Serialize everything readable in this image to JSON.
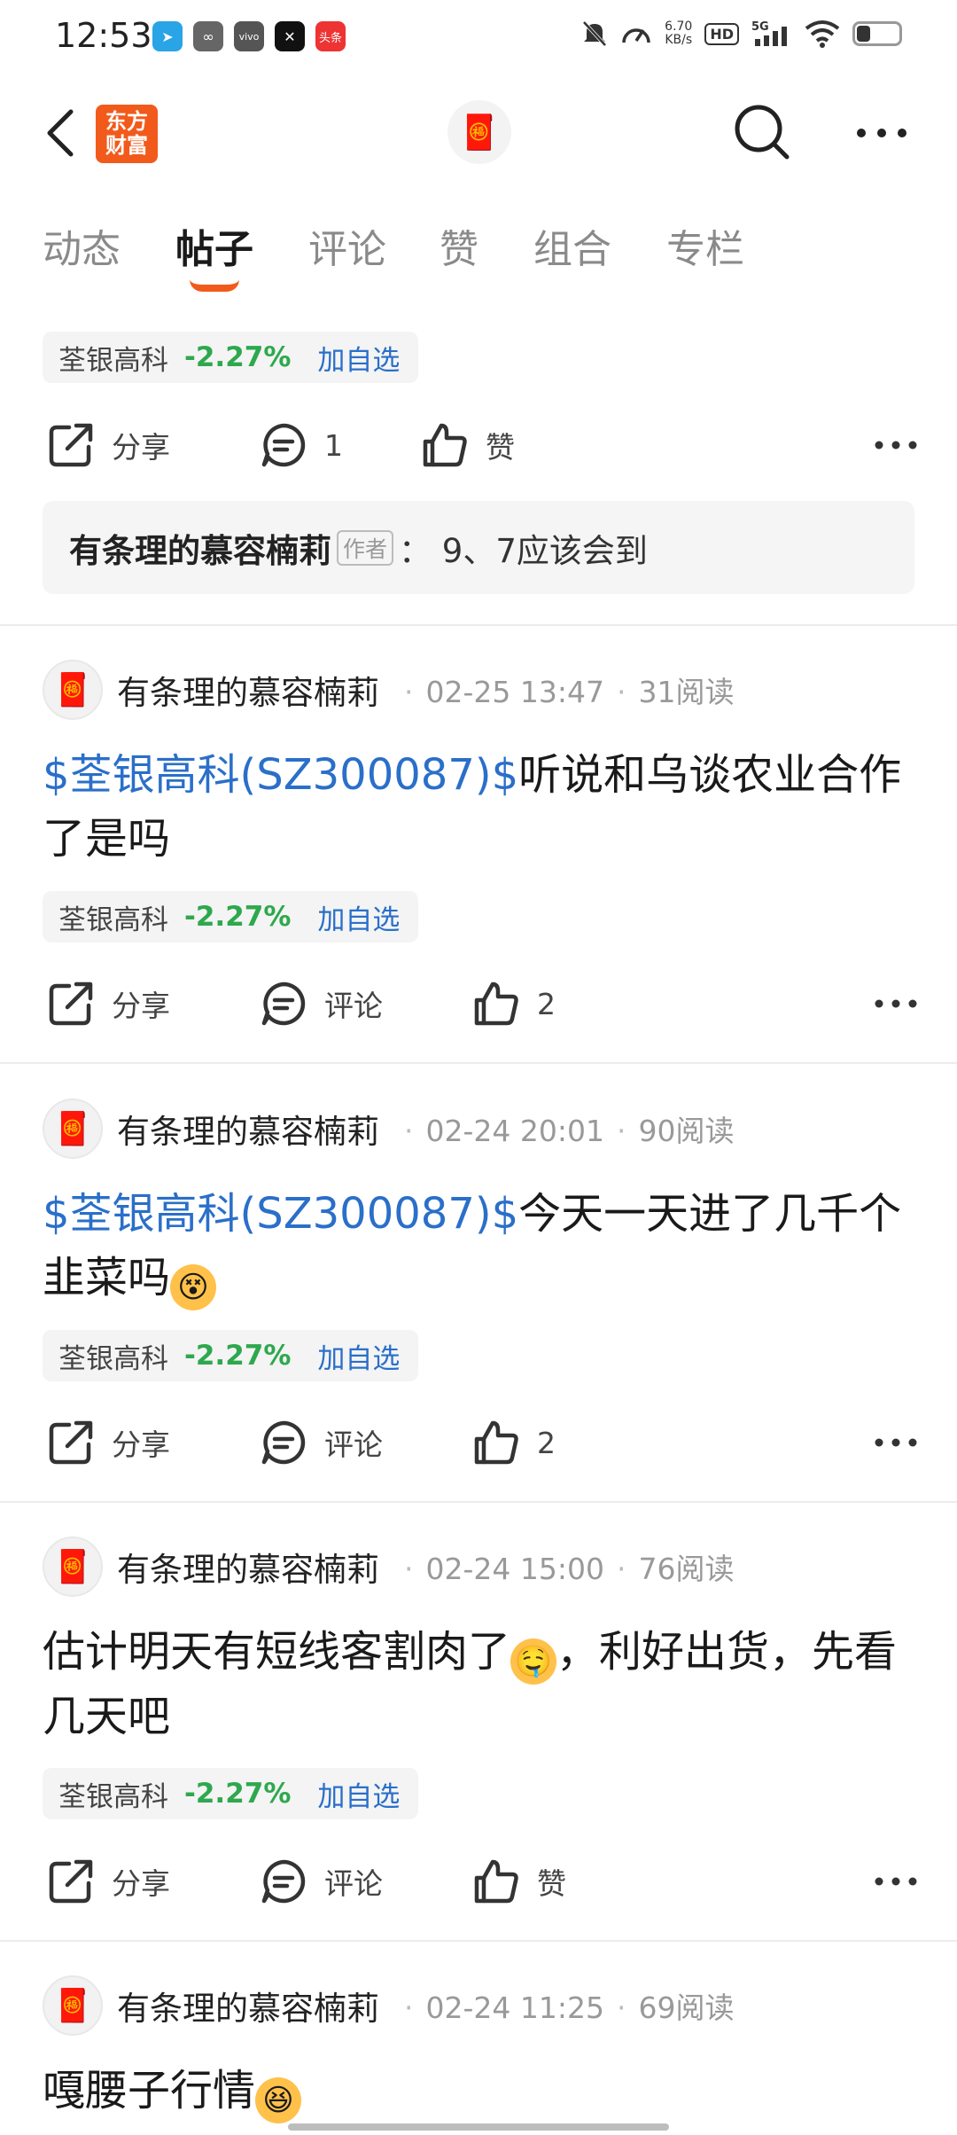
{
  "status_bar": {
    "time": "12:53",
    "apps": [
      "telegram",
      "link",
      "vivo",
      "capcut",
      "头条"
    ],
    "net_speed_value": "6.70",
    "net_speed_unit": "KB/s",
    "hd": "HD",
    "network": "5G"
  },
  "header": {
    "brand_line1": "东方",
    "brand_line2": "财富",
    "avatar_emoji": "🧧"
  },
  "tabs": [
    {
      "label": "动态"
    },
    {
      "label": "帖子"
    },
    {
      "label": "评论"
    },
    {
      "label": "赞"
    },
    {
      "label": "组合"
    },
    {
      "label": "专栏"
    }
  ],
  "active_tab": "帖子",
  "first_item": {
    "chip": {
      "name": "荃银高科",
      "change": "-2.27%",
      "add": "加自选"
    },
    "share": "分享",
    "comments": "1",
    "like": "赞",
    "comment_preview": {
      "author": "有条理的慕容楠莉",
      "author_tag": "作者",
      "text": "：  9、7应该会到"
    }
  },
  "posts": [
    {
      "author": "有条理的慕容楠莉",
      "time": "02-25 13:47",
      "reads": "31阅读",
      "stock_link": "$荃银高科(SZ300087)$",
      "text": "听说和乌谈农业合作了是吗",
      "chip": {
        "name": "荃银高科",
        "change": "-2.27%",
        "add": "加自选"
      },
      "share": "分享",
      "comment": "评论",
      "like": "2"
    },
    {
      "author": "有条理的慕容楠莉",
      "time": "02-24 20:01",
      "reads": "90阅读",
      "stock_link": "$荃银高科(SZ300087)$",
      "text": "今天一天进了几千个韭菜吗",
      "emoji": "😵",
      "chip": {
        "name": "荃银高科",
        "change": "-2.27%",
        "add": "加自选"
      },
      "share": "分享",
      "comment": "评论",
      "like": "2"
    },
    {
      "author": "有条理的慕容楠莉",
      "time": "02-24 15:00",
      "reads": "76阅读",
      "text_before": "估计明天有短线客割肉了",
      "emoji": "🤤",
      "text_after": "，利好出货，先看几天吧",
      "chip": {
        "name": "荃银高科",
        "change": "-2.27%",
        "add": "加自选"
      },
      "share": "分享",
      "comment": "评论",
      "like": "赞"
    },
    {
      "author": "有条理的慕容楠莉",
      "time": "02-24 11:25",
      "reads": "69阅读",
      "text": "嘎腰子行情",
      "emoji": "😆"
    }
  ]
}
